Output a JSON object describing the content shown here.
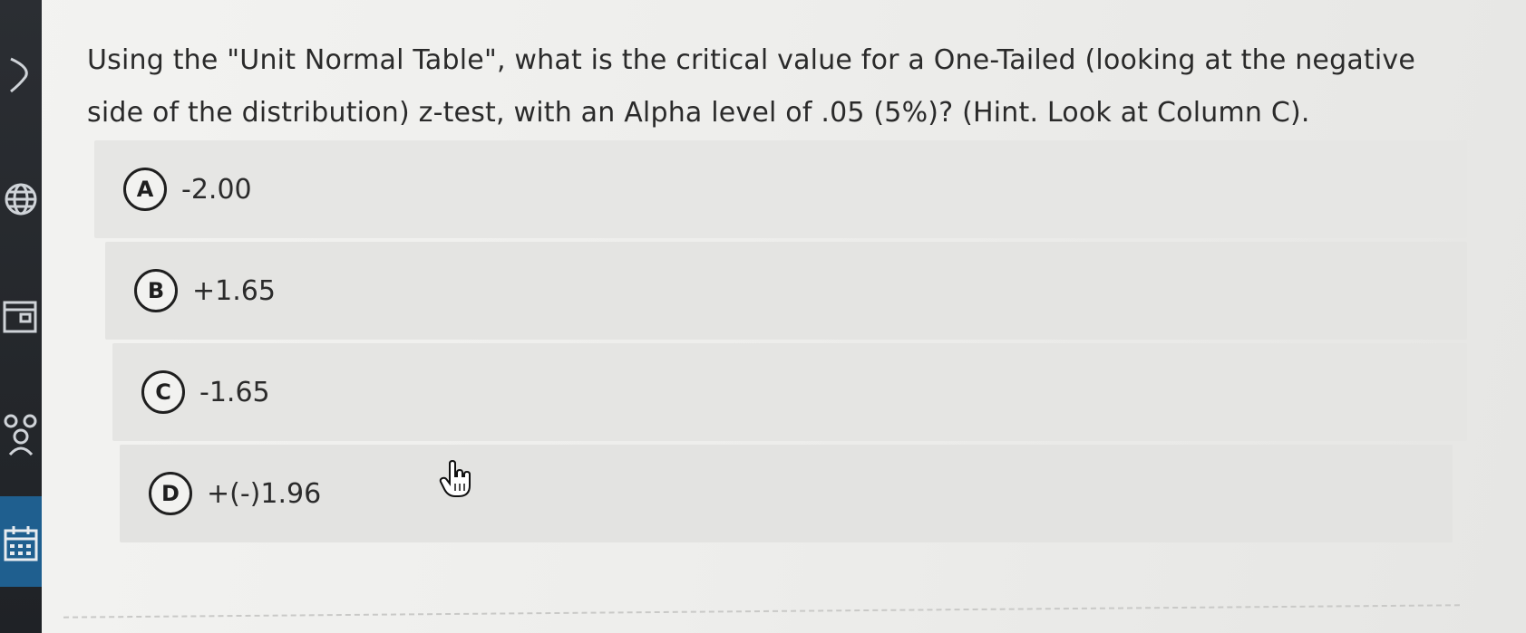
{
  "question": {
    "line1": "Using the \"Unit Normal Table\", what is the critical value for a One-Tailed (looking at the negative",
    "line2": "side of the distribution) z-test, with an Alpha level of .05 (5%)? (Hint. Look at Column C)."
  },
  "options": [
    {
      "letter": "A",
      "text": "-2.00"
    },
    {
      "letter": "B",
      "text": "+1.65"
    },
    {
      "letter": "C",
      "text": "-1.65"
    },
    {
      "letter": "D",
      "text": "+(-)1.96"
    }
  ],
  "sidebar": {
    "icons": [
      "chevron-icon",
      "globe-icon",
      "gradebook-icon",
      "groups-icon",
      "calendar-icon"
    ]
  },
  "colors": {
    "sidebar": "#24272b",
    "active": "#1f5f8f",
    "option_bg": "#e5e5e3",
    "text": "#2a2a2a"
  }
}
